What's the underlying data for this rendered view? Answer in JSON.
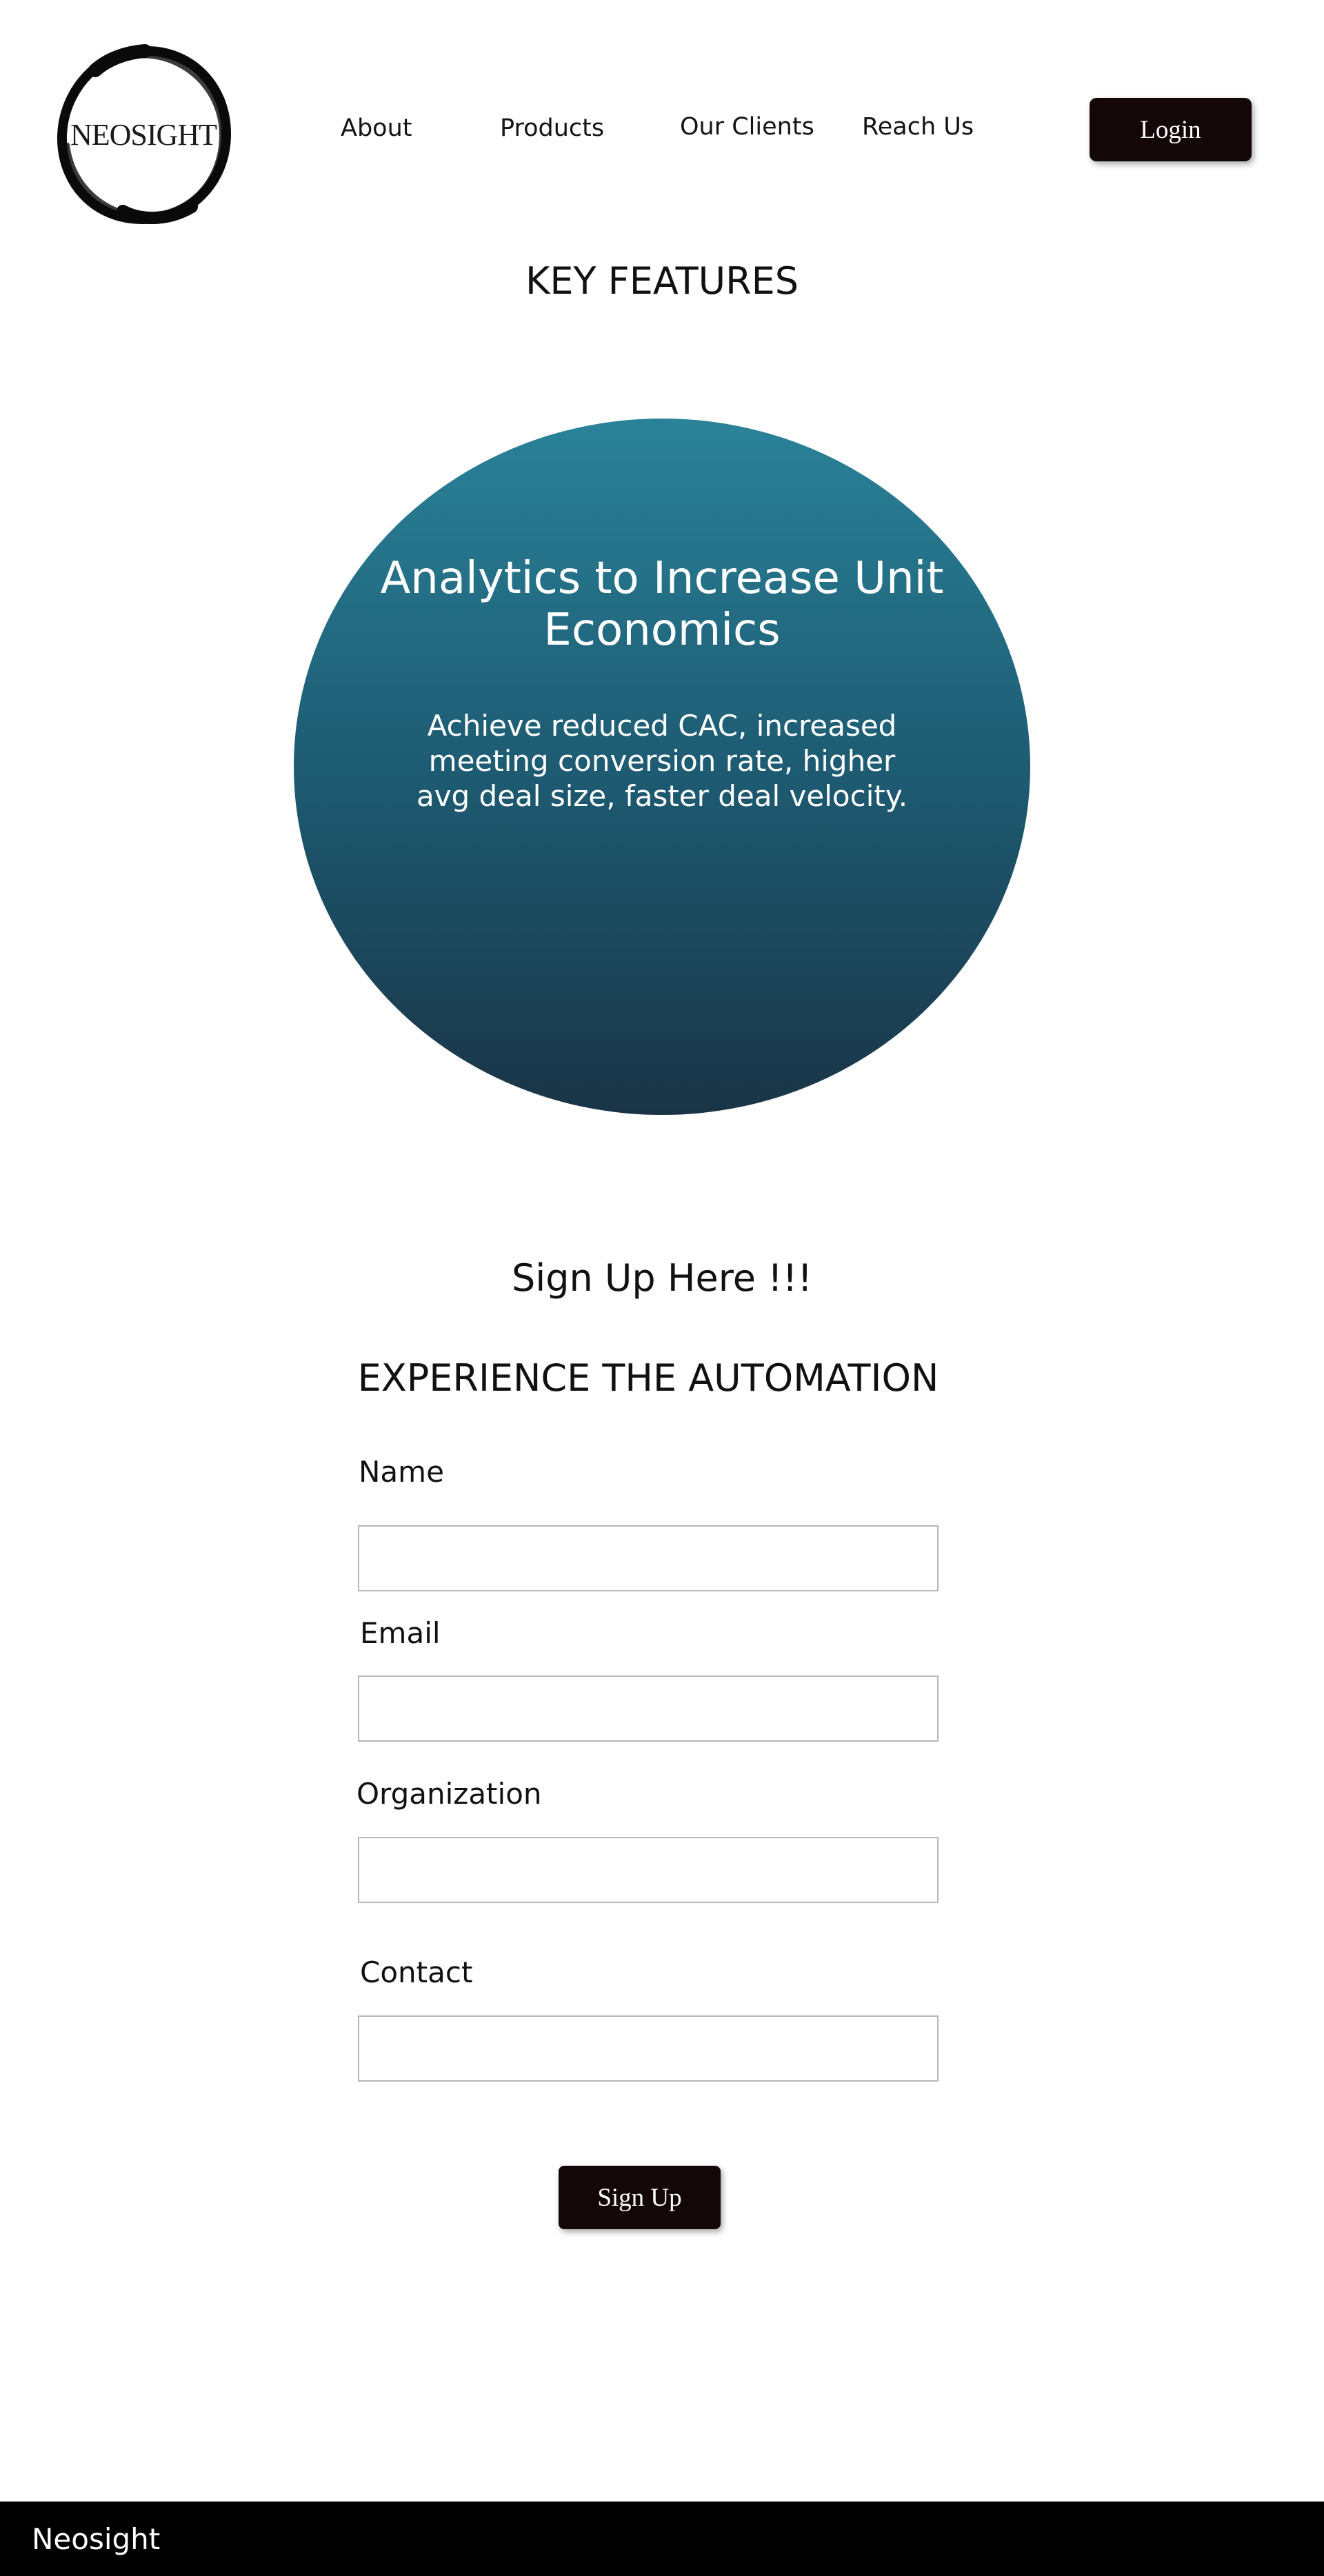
{
  "header": {
    "logo_text": "NEOSIGHT",
    "nav": [
      "About",
      "Products",
      "Our Clients",
      "Reach Us"
    ],
    "login_label": "Login"
  },
  "features": {
    "title": "KEY FEATURES",
    "card_title": "Analytics to Increase Unit Economics",
    "card_description": "Achieve reduced CAC, increased meeting conversion rate, higher avg deal size, faster deal velocity."
  },
  "signup": {
    "heading": "Sign Up Here !!!",
    "subheading": "EXPERIENCE THE AUTOMATION",
    "fields": {
      "name": {
        "label": "Name",
        "value": ""
      },
      "email": {
        "label": "Email",
        "value": ""
      },
      "organization": {
        "label": "Organization",
        "value": ""
      },
      "contact": {
        "label": "Contact",
        "value": ""
      }
    },
    "submit_label": "Sign Up"
  },
  "footer": {
    "brand": "Neosight"
  },
  "colors": {
    "button_bg": "#140707",
    "circle_gradient_top": "#2a8299",
    "circle_gradient_bottom": "#1a3446",
    "footer_bg": "#000000"
  }
}
